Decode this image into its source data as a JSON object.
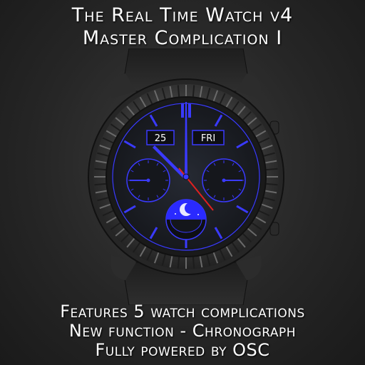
{
  "title": {
    "line1": "The Real Time Watch v4",
    "line2": "Master Complication I"
  },
  "watch": {
    "date_day": "25",
    "date_weekday": "FRI",
    "accent_color": "#3a3aff",
    "second_hand_color": "#e02020"
  },
  "features": {
    "line1": "Features 5 watch complications",
    "line2": "New function - Chronograph",
    "line3": "Fully powered by OSC"
  }
}
